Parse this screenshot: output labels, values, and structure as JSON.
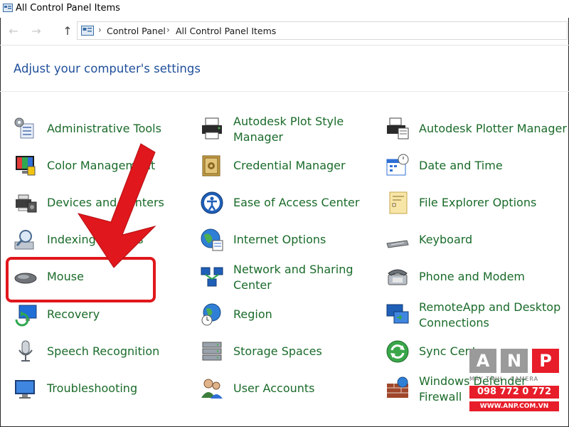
{
  "window": {
    "title": "All Control Panel Items"
  },
  "nav": {
    "back_glyph": "←",
    "forward_glyph": "→",
    "up_glyph": "↑",
    "breadcrumb": [
      "Control Panel",
      "All Control Panel Items"
    ],
    "separator": "›"
  },
  "page": {
    "heading": "Adjust your computer's settings"
  },
  "items": [
    {
      "label": "Administrative Tools",
      "icon": "administrative-tools-icon"
    },
    {
      "label": "Autodesk Plot Style Manager",
      "icon": "printer-icon"
    },
    {
      "label": "Autodesk Plotter Manager",
      "icon": "plotter-icon"
    },
    {
      "label": "Color Management",
      "icon": "color-management-icon"
    },
    {
      "label": "Credential Manager",
      "icon": "credential-vault-icon"
    },
    {
      "label": "Date and Time",
      "icon": "calendar-clock-icon"
    },
    {
      "label": "Devices and Printers",
      "icon": "devices-printers-icon"
    },
    {
      "label": "Ease of Access Center",
      "icon": "ease-of-access-icon"
    },
    {
      "label": "File Explorer Options",
      "icon": "folder-options-icon"
    },
    {
      "label": "Indexing Options",
      "icon": "indexing-icon"
    },
    {
      "label": "Internet Options",
      "icon": "globe-icon"
    },
    {
      "label": "Keyboard",
      "icon": "keyboard-icon"
    },
    {
      "label": "Mouse",
      "icon": "mouse-icon"
    },
    {
      "label": "Network and Sharing Center",
      "icon": "network-icon"
    },
    {
      "label": "Phone and Modem",
      "icon": "phone-icon"
    },
    {
      "label": "Recovery",
      "icon": "recovery-icon"
    },
    {
      "label": "Region",
      "icon": "region-globe-clock-icon"
    },
    {
      "label": "RemoteApp and Desktop Connections",
      "icon": "remote-desktop-icon"
    },
    {
      "label": "Speech Recognition",
      "icon": "microphone-icon"
    },
    {
      "label": "Storage Spaces",
      "icon": "storage-drives-icon"
    },
    {
      "label": "Sync Center",
      "icon": "sync-icon"
    },
    {
      "label": "Troubleshooting",
      "icon": "troubleshooting-icon"
    },
    {
      "label": "User Accounts",
      "icon": "user-accounts-icon"
    },
    {
      "label": "Windows Defender Firewall",
      "icon": "firewall-icon"
    }
  ],
  "watermark": {
    "letters": [
      "A",
      "N",
      "P"
    ],
    "subtitle": "MÁY TÍNH - CAMERA",
    "phone": "098 772 0 772",
    "website": "WWW.ANP.COM.VN"
  },
  "colors": {
    "link_green": "#1a6b2a",
    "heading_blue": "#1e4e9a",
    "highlight_red": "#e0171c",
    "brand_red": "#e71d2a",
    "brand_gray": "#9a9a9a"
  }
}
